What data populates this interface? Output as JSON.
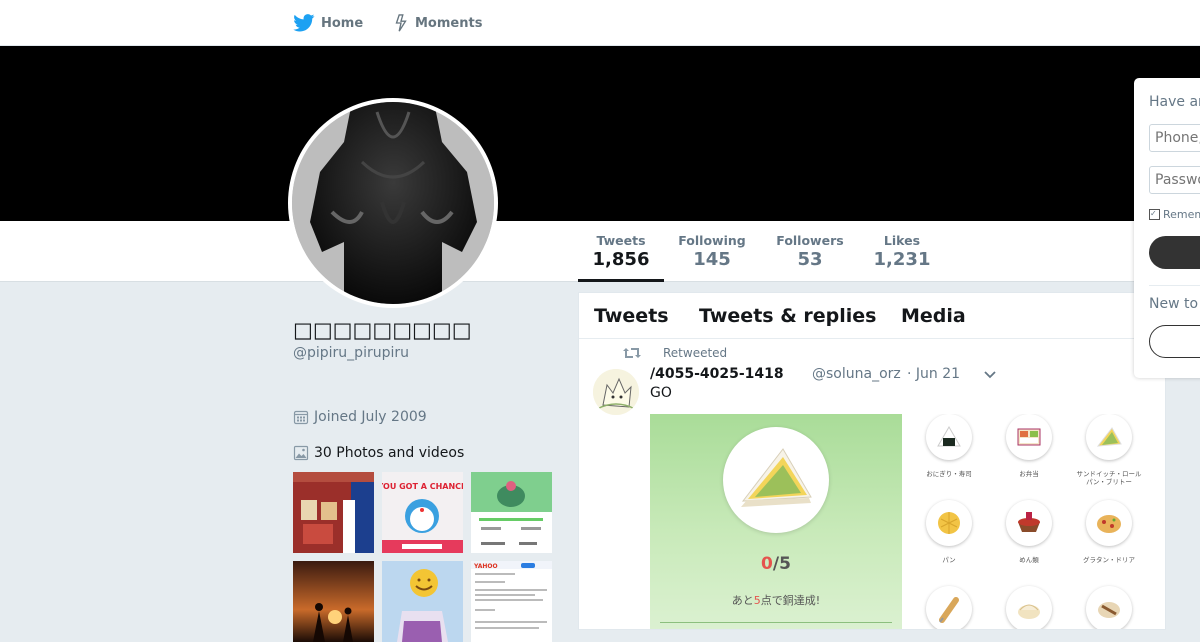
{
  "nav": {
    "home_label": "Home",
    "moments_label": "Moments"
  },
  "profile": {
    "name": "□□□□□□□□□",
    "handle": "@pipiru_pirupiru",
    "joined": "Joined July 2009",
    "photos_label": "30 Photos and videos"
  },
  "stats": [
    {
      "label": "Tweets",
      "value": "1,856"
    },
    {
      "label": "Following",
      "value": "145"
    },
    {
      "label": "Followers",
      "value": "53"
    },
    {
      "label": "Likes",
      "value": "1,231"
    }
  ],
  "timeline_tabs": [
    "Tweets",
    "Tweets & replies",
    "Media"
  ],
  "tweet": {
    "retweeted_label": "Retweeted",
    "name": "/4055-4025-1418",
    "handle": "@soluna_orz",
    "time": "· Jun 21",
    "text": "GO",
    "score": {
      "current": "0",
      "total": "/5"
    },
    "score_sub": {
      "pre": "あと",
      "num": "5",
      "post": "点で銅達成!"
    },
    "food_labels": [
      "おにぎり・寿司",
      "お弁当",
      "サンドイッチ・ロール パン・ブリトー",
      "パン",
      "めん類",
      "グラタン・ドリア"
    ]
  },
  "login": {
    "title": "Have an account?",
    "phone_placeholder": "Phone, email, or username",
    "password_placeholder": "Password",
    "remember_label": "Remember me",
    "new_to": "New to Twitter?"
  },
  "colors": {
    "accent": "#1da1f2",
    "banner": "#000000",
    "background": "#e6ecf0",
    "highlight_red": "#e5544e"
  }
}
